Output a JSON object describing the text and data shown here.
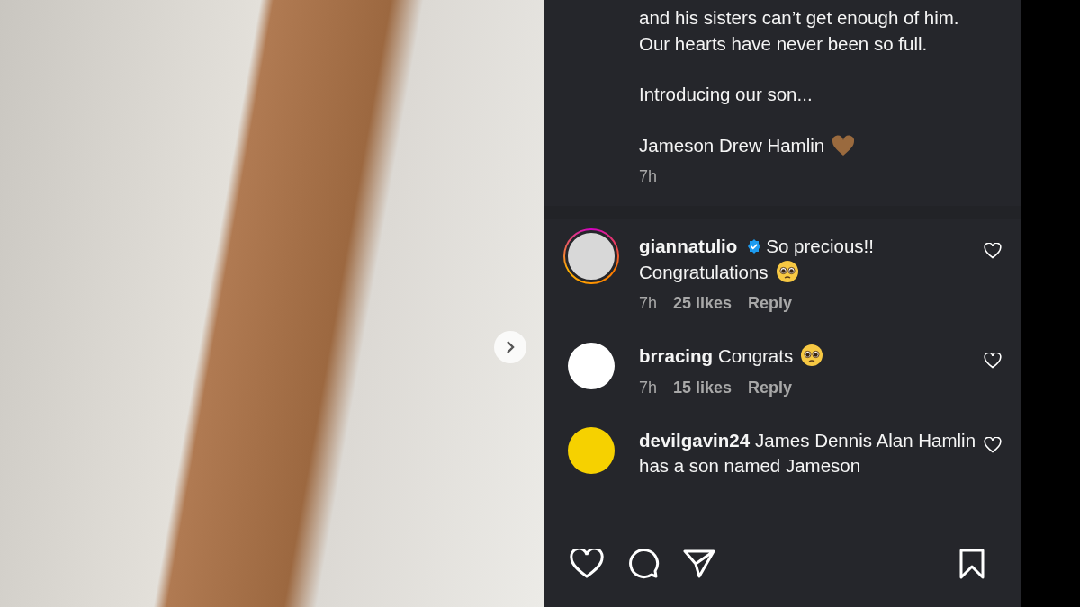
{
  "post": {
    "photo": {
      "has_next": true
    }
  },
  "caption": {
    "paragraphs": [
      "and his sisters can’t get enough of him. Our hearts have never been so full.",
      "Introducing our son...",
      "Jameson Drew Hamlin"
    ],
    "heart_emoji": true,
    "time": "7h"
  },
  "comments": [
    {
      "username": "giannatulio",
      "verified": true,
      "story_ring": true,
      "color": "#d8d8d8",
      "text": "So precious!! Congratulations",
      "emoji": true,
      "time": "7h",
      "likes": "25 likes",
      "reply": "Reply"
    },
    {
      "username": "brracing",
      "verified": false,
      "story_ring": false,
      "color": "#ffffff",
      "text": "Congrats",
      "emoji": true,
      "time": "7h",
      "likes": "15 likes",
      "reply": "Reply"
    },
    {
      "username": "devilgavin24",
      "verified": false,
      "story_ring": false,
      "color": "#f6d100",
      "text": "James Dennis Alan Hamlin has a son named Jameson",
      "emoji": false
    }
  ]
}
